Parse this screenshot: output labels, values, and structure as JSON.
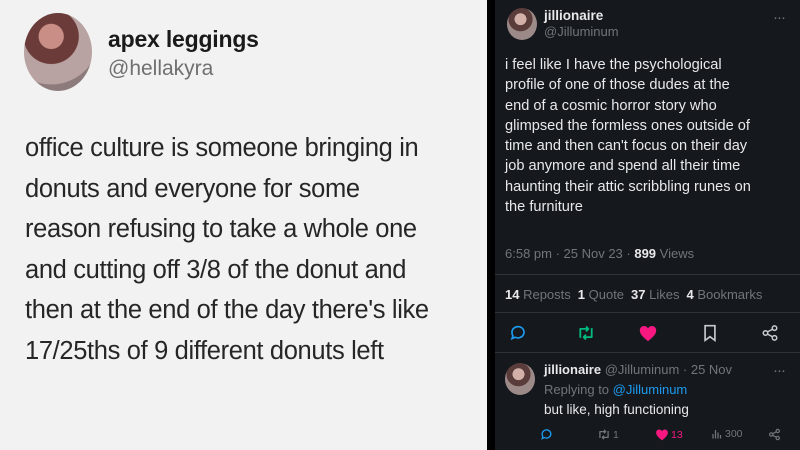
{
  "left_tweet": {
    "display_name": "apex leggings",
    "handle": "@hellakyra",
    "lines": [
      "office culture is someone bringing in",
      "donuts and everyone for some",
      "reason refusing to take a whole one",
      "and cutting off 3/8 of the donut and",
      "then at the end of the day there's like",
      "17/25ths of 9 different donuts left"
    ]
  },
  "right_tweet": {
    "display_name": "jillionaire",
    "handle": "@Jilluminum",
    "more": "···",
    "lines": [
      "i feel like I have the psychological",
      "profile of one of those dudes at the",
      "end of a cosmic horror story who",
      "glimpsed the formless ones outside of",
      "time and then can't focus on their day",
      "job anymore and spend all their time",
      "haunting their attic scribbling runes on",
      "the furniture"
    ],
    "meta": {
      "time_date": "6:58 pm · 25 Nov 23 · ",
      "views_count": "899",
      "views_label": " Views"
    },
    "stats": {
      "reposts_count": "14",
      "reposts_label": " Reposts",
      "quotes_count": "1",
      "quotes_label": " Quote",
      "likes_count": "37",
      "likes_label": " Likes",
      "bookmarks_count": "4",
      "bookmarks_label": " Bookmarks"
    },
    "actions": [
      "reply-icon",
      "repost-icon",
      "like-icon",
      "bookmark-icon",
      "share-icon"
    ],
    "colors": {
      "bg": "#15181d",
      "text": "#e7e9ea",
      "muted": "#71767b",
      "accent": "#1d9bf0",
      "like": "#f91880",
      "repost": "#00ba7c"
    }
  },
  "reply": {
    "display_name": "jillionaire",
    "handle_time": " @Jilluminum · 25 Nov",
    "replying_label": "Replying to ",
    "replying_handle": "@Jilluminum",
    "text": "but like, high functioning",
    "reposts": "1",
    "likes": "13",
    "views": "300",
    "more": "···"
  }
}
